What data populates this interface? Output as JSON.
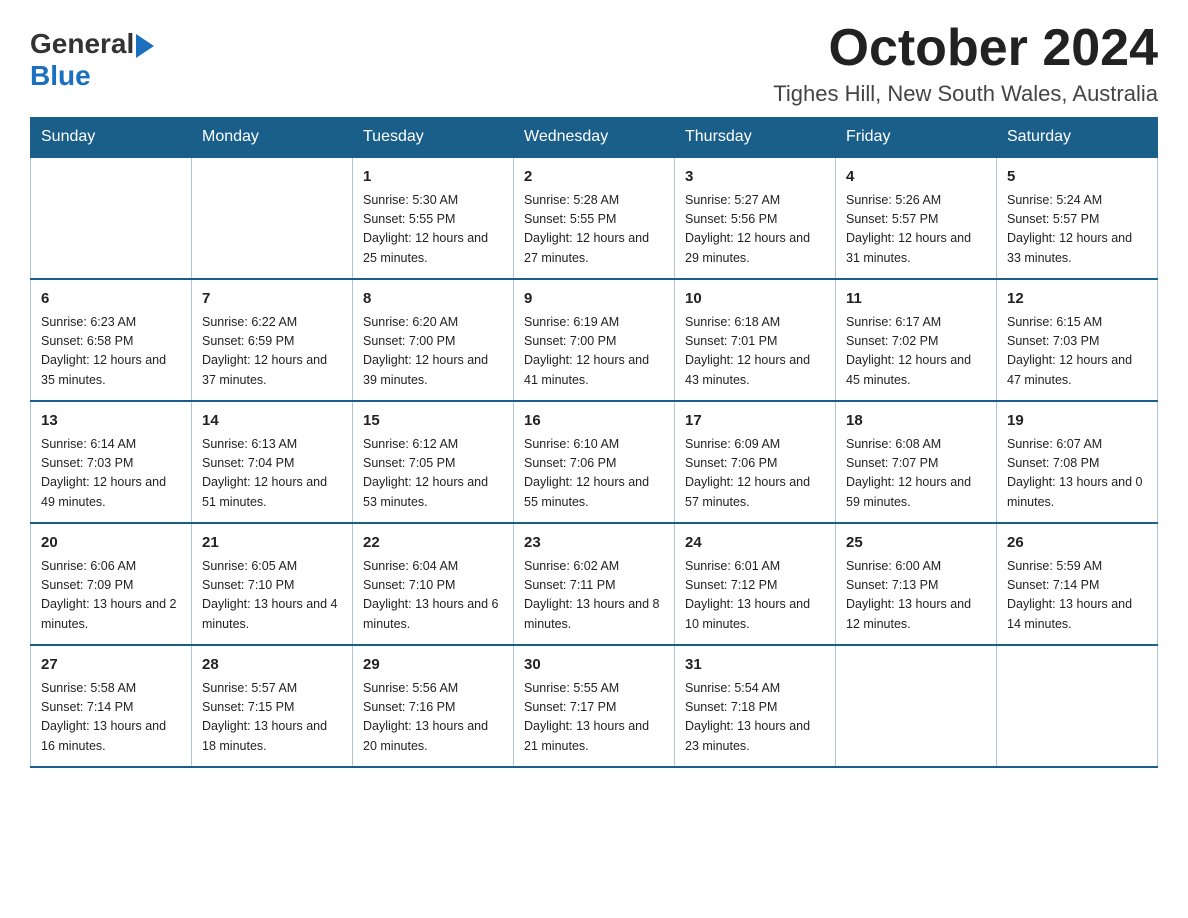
{
  "header": {
    "logo_general": "General",
    "logo_blue": "Blue",
    "month_year": "October 2024",
    "location": "Tighes Hill, New South Wales, Australia"
  },
  "calendar": {
    "days_of_week": [
      "Sunday",
      "Monday",
      "Tuesday",
      "Wednesday",
      "Thursday",
      "Friday",
      "Saturday"
    ],
    "weeks": [
      [
        {
          "day": "",
          "info": ""
        },
        {
          "day": "",
          "info": ""
        },
        {
          "day": "1",
          "info": "Sunrise: 5:30 AM\nSunset: 5:55 PM\nDaylight: 12 hours\nand 25 minutes."
        },
        {
          "day": "2",
          "info": "Sunrise: 5:28 AM\nSunset: 5:55 PM\nDaylight: 12 hours\nand 27 minutes."
        },
        {
          "day": "3",
          "info": "Sunrise: 5:27 AM\nSunset: 5:56 PM\nDaylight: 12 hours\nand 29 minutes."
        },
        {
          "day": "4",
          "info": "Sunrise: 5:26 AM\nSunset: 5:57 PM\nDaylight: 12 hours\nand 31 minutes."
        },
        {
          "day": "5",
          "info": "Sunrise: 5:24 AM\nSunset: 5:57 PM\nDaylight: 12 hours\nand 33 minutes."
        }
      ],
      [
        {
          "day": "6",
          "info": "Sunrise: 6:23 AM\nSunset: 6:58 PM\nDaylight: 12 hours\nand 35 minutes."
        },
        {
          "day": "7",
          "info": "Sunrise: 6:22 AM\nSunset: 6:59 PM\nDaylight: 12 hours\nand 37 minutes."
        },
        {
          "day": "8",
          "info": "Sunrise: 6:20 AM\nSunset: 7:00 PM\nDaylight: 12 hours\nand 39 minutes."
        },
        {
          "day": "9",
          "info": "Sunrise: 6:19 AM\nSunset: 7:00 PM\nDaylight: 12 hours\nand 41 minutes."
        },
        {
          "day": "10",
          "info": "Sunrise: 6:18 AM\nSunset: 7:01 PM\nDaylight: 12 hours\nand 43 minutes."
        },
        {
          "day": "11",
          "info": "Sunrise: 6:17 AM\nSunset: 7:02 PM\nDaylight: 12 hours\nand 45 minutes."
        },
        {
          "day": "12",
          "info": "Sunrise: 6:15 AM\nSunset: 7:03 PM\nDaylight: 12 hours\nand 47 minutes."
        }
      ],
      [
        {
          "day": "13",
          "info": "Sunrise: 6:14 AM\nSunset: 7:03 PM\nDaylight: 12 hours\nand 49 minutes."
        },
        {
          "day": "14",
          "info": "Sunrise: 6:13 AM\nSunset: 7:04 PM\nDaylight: 12 hours\nand 51 minutes."
        },
        {
          "day": "15",
          "info": "Sunrise: 6:12 AM\nSunset: 7:05 PM\nDaylight: 12 hours\nand 53 minutes."
        },
        {
          "day": "16",
          "info": "Sunrise: 6:10 AM\nSunset: 7:06 PM\nDaylight: 12 hours\nand 55 minutes."
        },
        {
          "day": "17",
          "info": "Sunrise: 6:09 AM\nSunset: 7:06 PM\nDaylight: 12 hours\nand 57 minutes."
        },
        {
          "day": "18",
          "info": "Sunrise: 6:08 AM\nSunset: 7:07 PM\nDaylight: 12 hours\nand 59 minutes."
        },
        {
          "day": "19",
          "info": "Sunrise: 6:07 AM\nSunset: 7:08 PM\nDaylight: 13 hours\nand 0 minutes."
        }
      ],
      [
        {
          "day": "20",
          "info": "Sunrise: 6:06 AM\nSunset: 7:09 PM\nDaylight: 13 hours\nand 2 minutes."
        },
        {
          "day": "21",
          "info": "Sunrise: 6:05 AM\nSunset: 7:10 PM\nDaylight: 13 hours\nand 4 minutes."
        },
        {
          "day": "22",
          "info": "Sunrise: 6:04 AM\nSunset: 7:10 PM\nDaylight: 13 hours\nand 6 minutes."
        },
        {
          "day": "23",
          "info": "Sunrise: 6:02 AM\nSunset: 7:11 PM\nDaylight: 13 hours\nand 8 minutes."
        },
        {
          "day": "24",
          "info": "Sunrise: 6:01 AM\nSunset: 7:12 PM\nDaylight: 13 hours\nand 10 minutes."
        },
        {
          "day": "25",
          "info": "Sunrise: 6:00 AM\nSunset: 7:13 PM\nDaylight: 13 hours\nand 12 minutes."
        },
        {
          "day": "26",
          "info": "Sunrise: 5:59 AM\nSunset: 7:14 PM\nDaylight: 13 hours\nand 14 minutes."
        }
      ],
      [
        {
          "day": "27",
          "info": "Sunrise: 5:58 AM\nSunset: 7:14 PM\nDaylight: 13 hours\nand 16 minutes."
        },
        {
          "day": "28",
          "info": "Sunrise: 5:57 AM\nSunset: 7:15 PM\nDaylight: 13 hours\nand 18 minutes."
        },
        {
          "day": "29",
          "info": "Sunrise: 5:56 AM\nSunset: 7:16 PM\nDaylight: 13 hours\nand 20 minutes."
        },
        {
          "day": "30",
          "info": "Sunrise: 5:55 AM\nSunset: 7:17 PM\nDaylight: 13 hours\nand 21 minutes."
        },
        {
          "day": "31",
          "info": "Sunrise: 5:54 AM\nSunset: 7:18 PM\nDaylight: 13 hours\nand 23 minutes."
        },
        {
          "day": "",
          "info": ""
        },
        {
          "day": "",
          "info": ""
        }
      ]
    ]
  }
}
